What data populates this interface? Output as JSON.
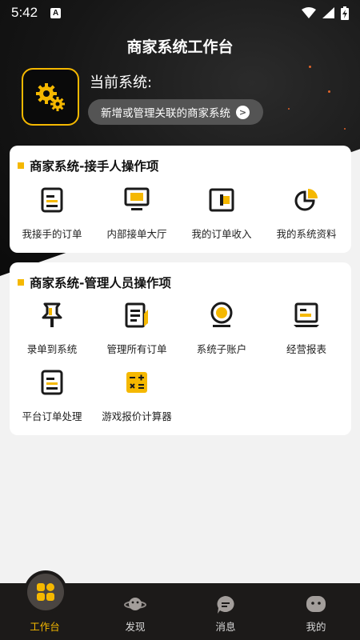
{
  "status_bar": {
    "time": "5:42",
    "badge": "A"
  },
  "header": {
    "title": "商家系统工作台",
    "current_system_label": "当前系统:",
    "manage_button": "新增或管理关联的商家系统",
    "manage_button_arrow": ">"
  },
  "receiver_section": {
    "title": "商家系统-接手人操作项",
    "items": [
      {
        "label": "我接手的订单",
        "icon": "document-icon"
      },
      {
        "label": "内部接单大厅",
        "icon": "monitor-icon"
      },
      {
        "label": "我的订单收入",
        "icon": "wallet-icon"
      },
      {
        "label": "我的系统资料",
        "icon": "pie-chart-icon"
      }
    ]
  },
  "manager_section": {
    "title": "商家系统-管理人员操作项",
    "items": [
      {
        "label": "录单到系统",
        "icon": "pin-icon"
      },
      {
        "label": "管理所有订单",
        "icon": "edit-document-icon"
      },
      {
        "label": "系统子账户",
        "icon": "user-coin-icon"
      },
      {
        "label": "经营报表",
        "icon": "report-icon"
      },
      {
        "label": "平台订单处理",
        "icon": "document-icon"
      },
      {
        "label": "游戏报价计算器",
        "icon": "calculator-icon"
      }
    ]
  },
  "tab_bar": {
    "tabs": [
      {
        "label": "工作台",
        "icon": "workspace-icon",
        "active": true
      },
      {
        "label": "发现",
        "icon": "planet-icon",
        "active": false
      },
      {
        "label": "消息",
        "icon": "chat-icon",
        "active": false
      },
      {
        "label": "我的",
        "icon": "profile-icon",
        "active": false
      }
    ]
  },
  "colors": {
    "accent": "#f5b800",
    "header_bg": "#161616",
    "tabbar_bg": "#1c1a19",
    "page_bg": "#f2f2f2"
  }
}
